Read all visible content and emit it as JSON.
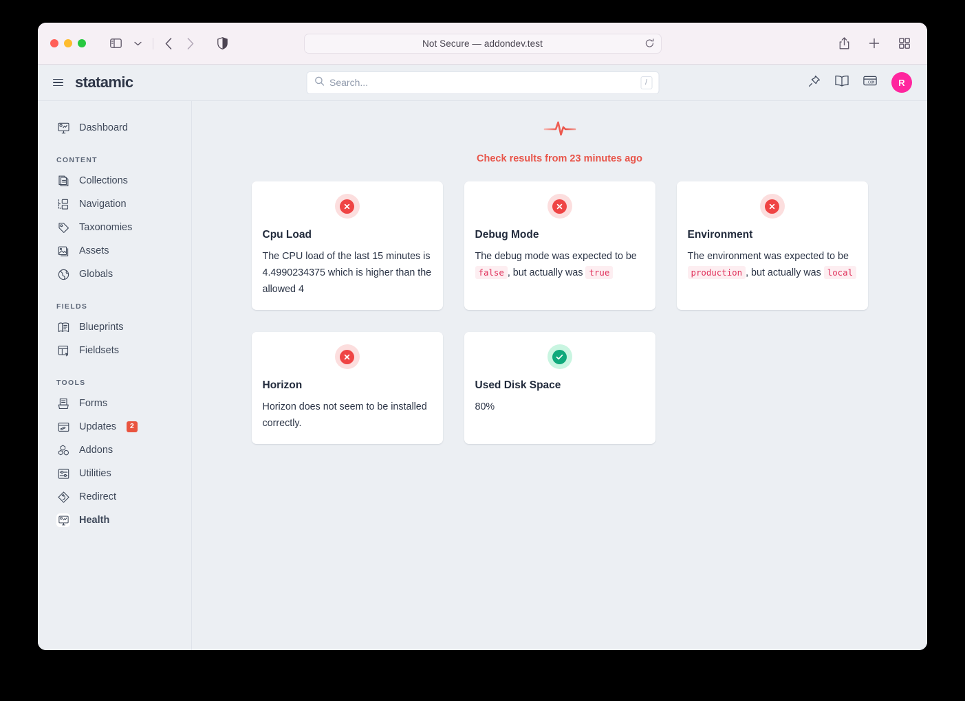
{
  "browser": {
    "url_text": "Not Secure — addondev.test",
    "sidebar_toggle": "sidebar-toggle",
    "back": "Back",
    "forward": "Forward",
    "share": "Share",
    "new_tab": "New Tab",
    "tab_overview": "Tab Overview",
    "reload": "Reload"
  },
  "topbar": {
    "brand": "statamic",
    "menu_label": "Menu",
    "search": {
      "placeholder": "Search...",
      "value": "",
      "shortcut": "/"
    },
    "actions": [
      {
        "name": "pin-icon",
        "label": "Pinned"
      },
      {
        "name": "book-icon",
        "label": "Documentation"
      },
      {
        "name": "com-icon",
        "label": "Visit Site"
      }
    ],
    "avatar_initial": "R",
    "avatar_color": "#ff269e"
  },
  "sidebar": {
    "top": [
      {
        "label": "Dashboard",
        "icon": "dashboard-icon",
        "active": false
      }
    ],
    "sections": [
      {
        "label": "CONTENT",
        "items": [
          {
            "label": "Collections",
            "icon": "collections-icon",
            "active": false
          },
          {
            "label": "Navigation",
            "icon": "navigation-icon",
            "active": false
          },
          {
            "label": "Taxonomies",
            "icon": "taxonomies-icon",
            "active": false
          },
          {
            "label": "Assets",
            "icon": "assets-icon",
            "active": false
          },
          {
            "label": "Globals",
            "icon": "globals-icon",
            "active": false
          }
        ]
      },
      {
        "label": "FIELDS",
        "items": [
          {
            "label": "Blueprints",
            "icon": "blueprints-icon",
            "active": false
          },
          {
            "label": "Fieldsets",
            "icon": "fieldsets-icon",
            "active": false
          }
        ]
      },
      {
        "label": "TOOLS",
        "items": [
          {
            "label": "Forms",
            "icon": "forms-icon",
            "active": false
          },
          {
            "label": "Updates",
            "icon": "updates-icon",
            "active": false,
            "badge": "2"
          },
          {
            "label": "Addons",
            "icon": "addons-icon",
            "active": false
          },
          {
            "label": "Utilities",
            "icon": "utilities-icon",
            "active": false
          },
          {
            "label": "Redirect",
            "icon": "redirect-icon",
            "active": false
          },
          {
            "label": "Health",
            "icon": "health-icon",
            "active": true
          }
        ]
      }
    ]
  },
  "main": {
    "status_text": "Check results from 23 minutes ago",
    "status_color": "#e8554a",
    "pulse_icon": "heartbeat-icon",
    "cards": [
      {
        "title": "Cpu Load",
        "status": "fail",
        "status_icon": "error-x-icon",
        "parts": [
          {
            "type": "text",
            "value": "The CPU load of the last 15 minutes is 4.4990234375 which is higher than the allowed 4"
          }
        ]
      },
      {
        "title": "Debug Mode",
        "status": "fail",
        "status_icon": "error-x-icon",
        "parts": [
          {
            "type": "text",
            "value": "The debug mode was expected to be "
          },
          {
            "type": "code",
            "value": "false"
          },
          {
            "type": "text",
            "value": ", but actually was "
          },
          {
            "type": "code",
            "value": "true"
          }
        ]
      },
      {
        "title": "Environment",
        "status": "fail",
        "status_icon": "error-x-icon",
        "parts": [
          {
            "type": "text",
            "value": "The environment was expected to be "
          },
          {
            "type": "code",
            "value": "production"
          },
          {
            "type": "text",
            "value": ", but actually was "
          },
          {
            "type": "code",
            "value": "local"
          }
        ]
      },
      {
        "title": "Horizon",
        "status": "fail",
        "status_icon": "error-x-icon",
        "short": true,
        "parts": [
          {
            "type": "text",
            "value": "Horizon does not seem to be installed correctly."
          }
        ]
      },
      {
        "title": "Used Disk Space",
        "status": "ok",
        "status_icon": "success-check-icon",
        "short": true,
        "parts": [
          {
            "type": "text",
            "value": "80%"
          }
        ]
      }
    ]
  },
  "colors": {
    "fail": "#ef4444",
    "ok": "#0fa97b",
    "badge": "#e9543f",
    "page_bg": "#eceff3",
    "card_bg": "#ffffff"
  }
}
